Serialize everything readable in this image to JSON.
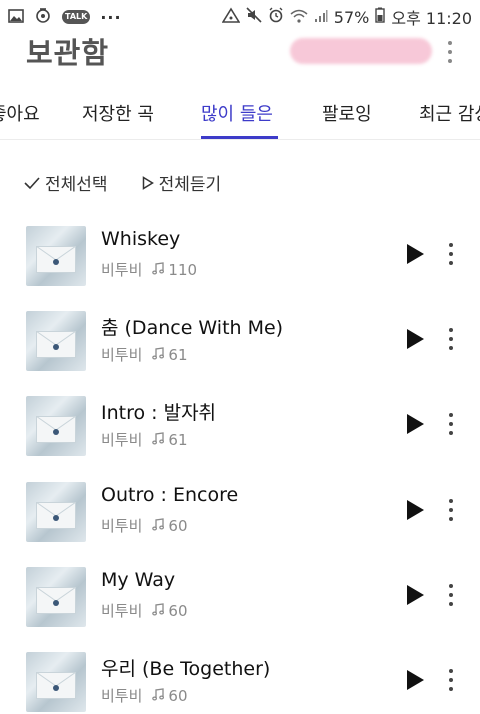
{
  "status_bar": {
    "battery": "57%",
    "time": "오후 11:20",
    "left_icons": [
      "image-icon",
      "alarm-badge-icon",
      "kakaotalk-icon",
      "more-dots-icon"
    ],
    "talk_badge": "TALK",
    "right_icons": [
      "hotspot-icon",
      "mute-icon",
      "alarm-icon",
      "wifi-icon",
      "signal-icon",
      "battery-icon"
    ]
  },
  "header": {
    "title": "보관함"
  },
  "tabs": [
    {
      "label": "좋아요"
    },
    {
      "label": "저장한 곡"
    },
    {
      "label": "많이 들은",
      "active": true
    },
    {
      "label": "팔로잉"
    },
    {
      "label": "최근 감상"
    }
  ],
  "actions": {
    "select_all": "전체선택",
    "play_all": "전체듣기"
  },
  "songs": [
    {
      "title": "Whiskey",
      "artist": "비투비",
      "plays": "110"
    },
    {
      "title": "춤 (Dance With Me)",
      "artist": "비투비",
      "plays": "61"
    },
    {
      "title": "Intro : 발자취",
      "artist": "비투비",
      "plays": "61"
    },
    {
      "title": "Outro : Encore",
      "artist": "비투비",
      "plays": "60"
    },
    {
      "title": "My Way",
      "artist": "비투비",
      "plays": "60"
    },
    {
      "title": "우리 (Be Together)",
      "artist": "비투비",
      "plays": "60"
    }
  ],
  "colors": {
    "accent": "#3d3bc9",
    "text": "#111111",
    "meta": "#8a8a8a"
  }
}
